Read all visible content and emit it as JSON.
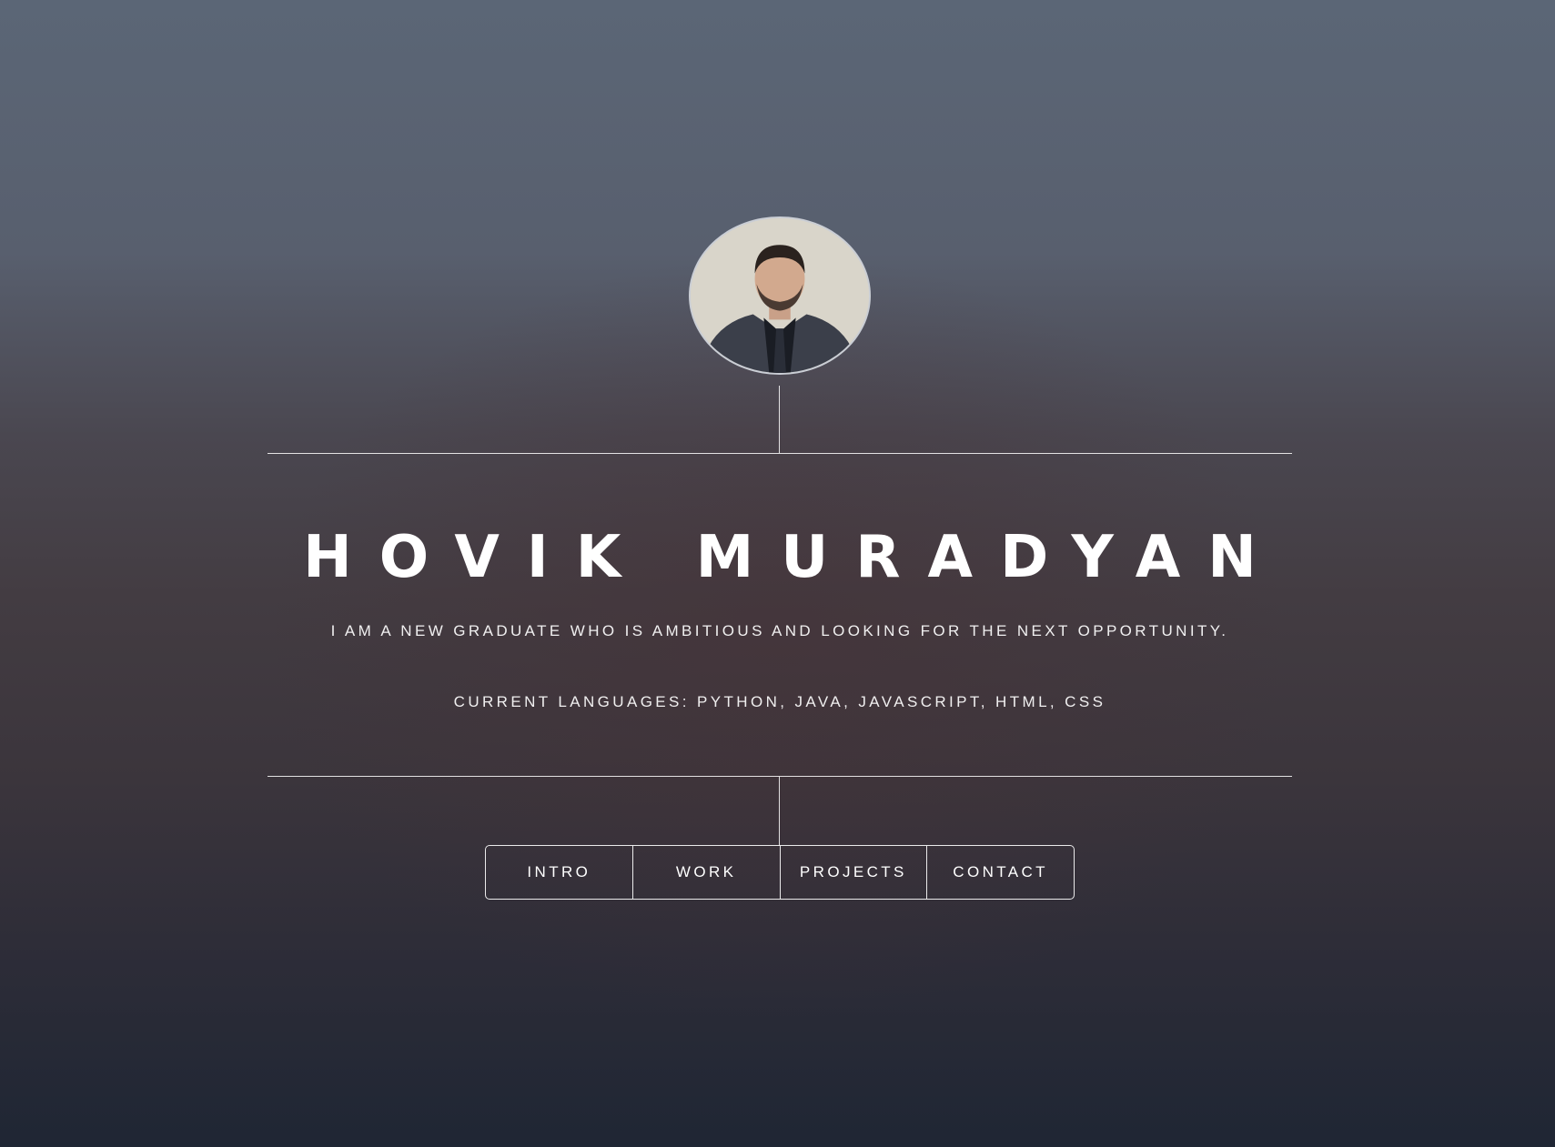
{
  "header": {
    "name": "HOVIK MURADYAN",
    "tagline": "I AM A NEW GRADUATE WHO IS AMBITIOUS AND LOOKING FOR THE NEXT OPPORTUNITY.",
    "languages": "CURRENT LANGUAGES: PYTHON, JAVA, JAVASCRIPT, HTML, CSS"
  },
  "nav": {
    "items": [
      {
        "label": "INTRO"
      },
      {
        "label": "WORK"
      },
      {
        "label": "PROJECTS"
      },
      {
        "label": "CONTACT"
      }
    ]
  }
}
